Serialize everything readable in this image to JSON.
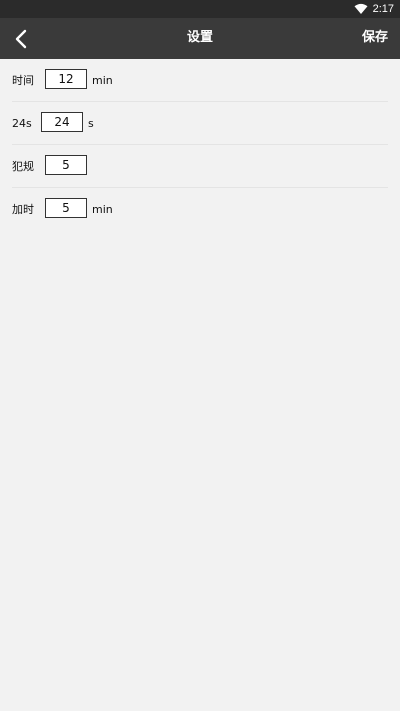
{
  "status_bar": {
    "time": "2:17",
    "wifi_icon": "wifi-icon"
  },
  "toolbar": {
    "back_icon": "chevron-left-icon",
    "title": "设置",
    "save_label": "保存"
  },
  "settings": [
    {
      "label": "时间",
      "value": "12",
      "unit": "min"
    },
    {
      "label": "24s",
      "value": "24",
      "unit": "s"
    },
    {
      "label": "犯规",
      "value": "5",
      "unit": ""
    },
    {
      "label": "加时",
      "value": "5",
      "unit": "min"
    }
  ]
}
